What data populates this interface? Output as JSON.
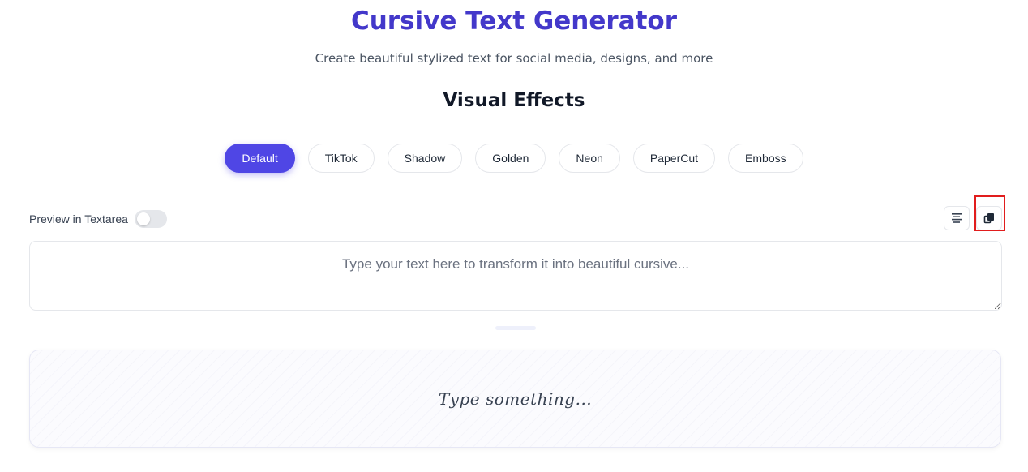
{
  "header": {
    "title": "Cursive Text Generator",
    "subtitle": "Create beautiful stylized text for social media, designs, and more",
    "section_title": "Visual Effects"
  },
  "effects": [
    {
      "label": "Default",
      "active": true
    },
    {
      "label": "TikTok",
      "active": false
    },
    {
      "label": "Shadow",
      "active": false
    },
    {
      "label": "Golden",
      "active": false
    },
    {
      "label": "Neon",
      "active": false
    },
    {
      "label": "PaperCut",
      "active": false
    },
    {
      "label": "Emboss",
      "active": false
    }
  ],
  "toolbar": {
    "preview_toggle_label": "Preview in Textarea",
    "preview_toggle_on": false,
    "align_icon": "align-center-icon",
    "copy_icon": "copy-icon"
  },
  "editor": {
    "value": "",
    "placeholder": "Type your text here to transform it into beautiful cursive..."
  },
  "preview": {
    "text": "Type something..."
  },
  "colors": {
    "accent": "#4f46e5",
    "title": "#4338ca",
    "highlight": "#e11d1d"
  }
}
